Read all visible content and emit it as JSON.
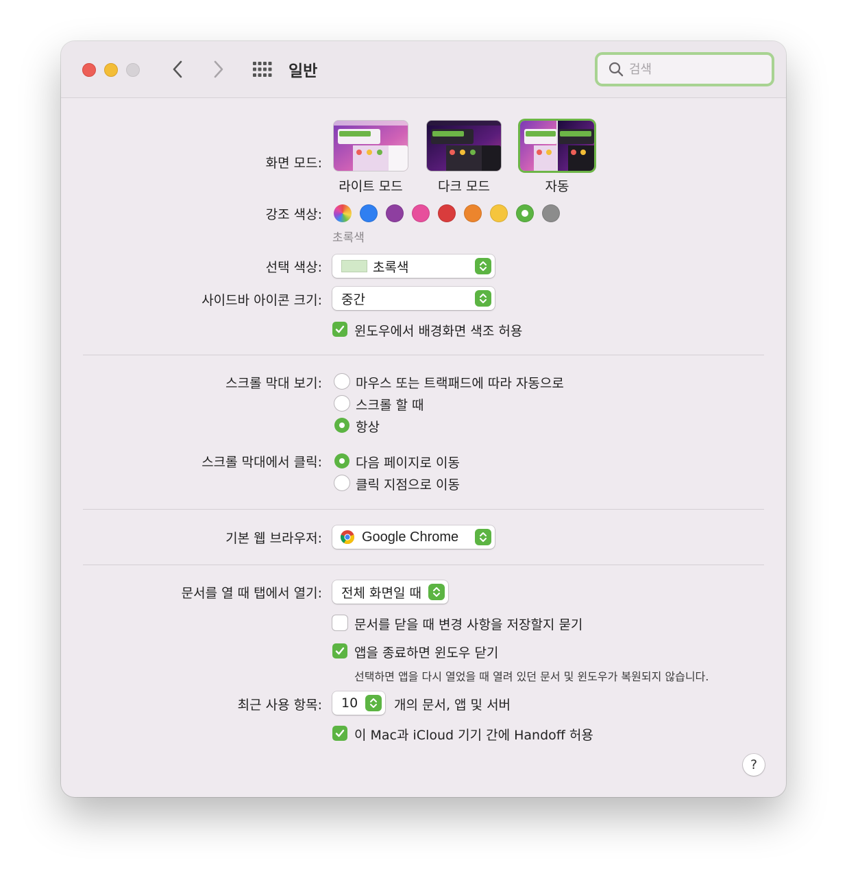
{
  "window": {
    "title": "일반",
    "search_placeholder": "검색"
  },
  "appearance": {
    "label": "화면 모드:",
    "modes": [
      {
        "label": "라이트 모드",
        "selected": false
      },
      {
        "label": "다크 모드",
        "selected": false
      },
      {
        "label": "자동",
        "selected": true
      }
    ]
  },
  "accent": {
    "label": "강조 색상:",
    "selected_name": "초록색",
    "colors": [
      "multicolor",
      "#2f7ff1",
      "#8e3fa0",
      "#e74f9c",
      "#d93c3c",
      "#ec852d",
      "#f5c53d",
      "#5cb443",
      "#8c8c8c"
    ],
    "selected_index": 7
  },
  "highlight": {
    "label": "선택 색상:",
    "value": "초록색",
    "swatch_color": "#d2e9c8"
  },
  "sidebar_icon_size": {
    "label": "사이드바 아이콘 크기:",
    "value": "중간"
  },
  "wallpaper_tinting": {
    "label": "윈도우에서 배경화면 색조 허용",
    "checked": true
  },
  "show_scrollbars": {
    "label": "스크롤 막대 보기:",
    "options": [
      {
        "label": "마우스 또는 트랙패드에 따라 자동으로",
        "selected": false
      },
      {
        "label": "스크롤 할 때",
        "selected": false
      },
      {
        "label": "항상",
        "selected": true
      }
    ]
  },
  "click_scrollbar": {
    "label": "스크롤 막대에서 클릭:",
    "options": [
      {
        "label": "다음 페이지로 이동",
        "selected": true
      },
      {
        "label": "클릭 지점으로 이동",
        "selected": false
      }
    ]
  },
  "default_browser": {
    "label": "기본 웹 브라우저:",
    "value": "Google Chrome"
  },
  "prefer_tabs": {
    "label": "문서를 열 때 탭에서 열기:",
    "value": "전체 화면일 때"
  },
  "ask_keep_changes": {
    "label": "문서를 닫을 때 변경 사항을 저장할지 묻기",
    "checked": false
  },
  "close_windows": {
    "label": "앱을 종료하면 윈도우 닫기",
    "checked": true,
    "note": "선택하면 앱을 다시 열었을 때 열려 있던 문서 및 윈도우가 복원되지 않습니다."
  },
  "recent_items": {
    "label": "최근 사용 항목:",
    "value": "10",
    "suffix": "개의 문서, 앱 및 서버"
  },
  "handoff": {
    "label": "이 Mac과 iCloud 기기 간에 Handoff 허용",
    "checked": true
  },
  "help": {
    "label": "?"
  },
  "colors": {
    "accent": "#5cb443",
    "close": "#ed5f57",
    "minimize": "#f3bd37",
    "zoom": "#d6d2d6"
  }
}
